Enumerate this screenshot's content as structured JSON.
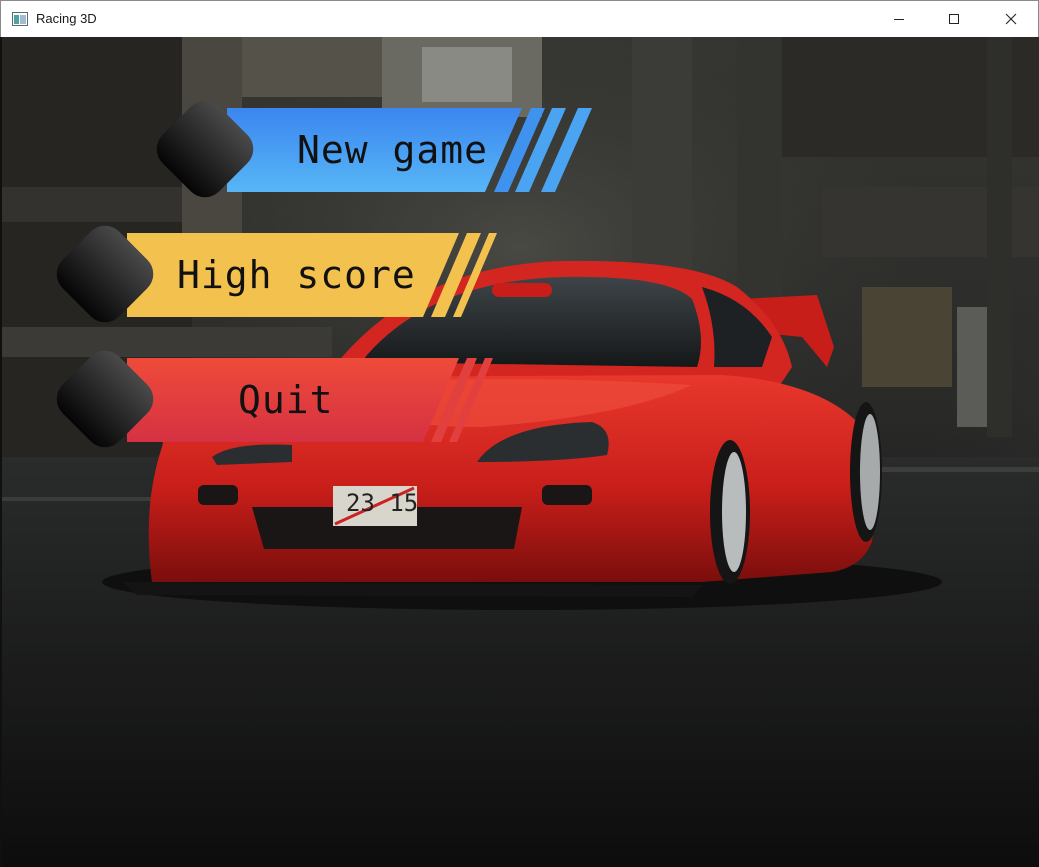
{
  "window": {
    "title": "Racing 3D",
    "icons": {
      "app": "app-window-icon",
      "minimize": "minimize-icon",
      "maximize": "maximize-icon",
      "close": "close-icon"
    }
  },
  "scene": {
    "description_icon": "red-sports-car-background",
    "plate_text": "23 15"
  },
  "menu": {
    "items": [
      {
        "label": "New game",
        "color_top": "#3f8cf0",
        "color_bottom": "#52b2f5"
      },
      {
        "label": "High score",
        "color_top": "#f2c14e",
        "color_bottom": "#f2c14e"
      },
      {
        "label": "Quit",
        "color_top": "#ee4a3a",
        "color_bottom": "#d8323f"
      }
    ],
    "diamond_icon": "dark-diamond-icon"
  }
}
